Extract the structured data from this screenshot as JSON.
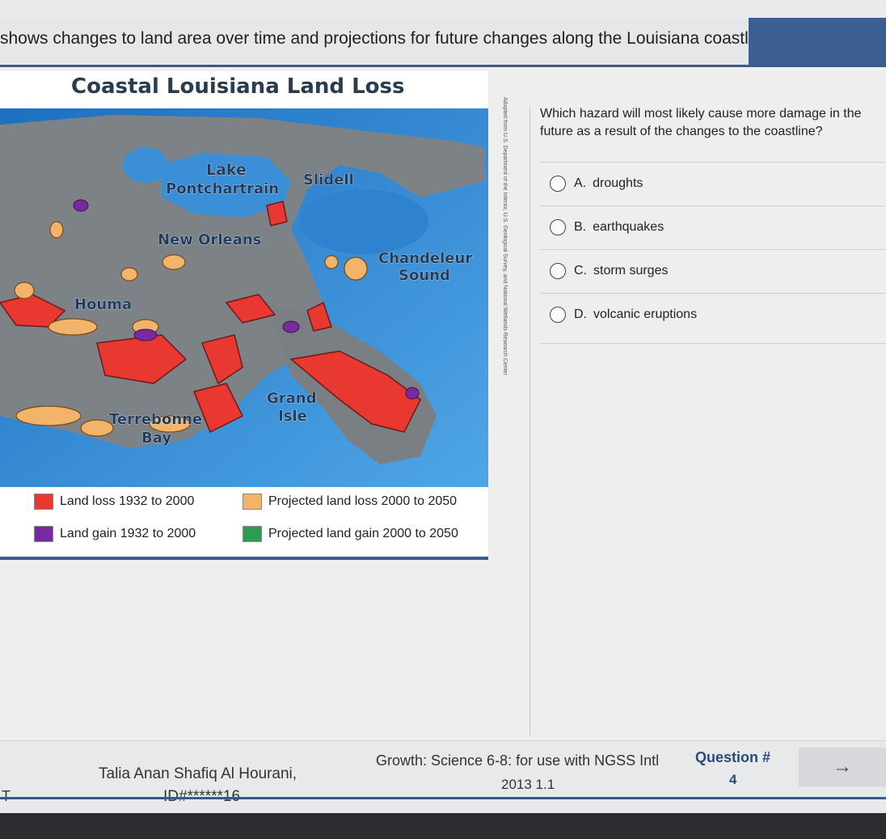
{
  "header": {
    "text": "shows changes to land area over time and projections for future changes along the Louisiana coastline."
  },
  "map": {
    "title": "Coastal Louisiana Land Loss",
    "labels": {
      "lake": "Lake",
      "pontchartrain": "Pontchartrain",
      "slidell": "Slidell",
      "new_orleans": "New Orleans",
      "chandeleur": "Chandeleur",
      "sound": "Sound",
      "houma": "Houma",
      "grand": "Grand",
      "isle": "Isle",
      "terrebonne": "Terrebonne",
      "bay": "Bay"
    },
    "credit": "Adapted from U.S. Department of the Interior, U.S. Geological Survey, and National Wetlands Research Center",
    "legend": [
      {
        "label": "Land loss 1932 to 2000",
        "color": "#e8382f"
      },
      {
        "label": "Projected land loss 2000 to 2050",
        "color": "#f2b36a"
      },
      {
        "label": "Land gain 1932 to 2000",
        "color": "#7a2aa0"
      },
      {
        "label": "Projected land gain 2000 to 2050",
        "color": "#2e9a52"
      }
    ]
  },
  "question": {
    "prompt_line1": "Which hazard will most likely cause more damage in the",
    "prompt_line2": "future as a result of the changes to the coastline?",
    "choices": [
      {
        "letter": "A.",
        "text": "droughts"
      },
      {
        "letter": "B.",
        "text": "earthquakes"
      },
      {
        "letter": "C.",
        "text": "storm surges"
      },
      {
        "letter": "D.",
        "text": "volcanic eruptions"
      }
    ]
  },
  "footer": {
    "left_mark": "T",
    "student_name": "Talia Anan Shafiq Al Hourani,",
    "student_id": "ID#******16",
    "course_line1": "Growth: Science 6-8: for use with NGSS Intl",
    "course_line2": "2013 1.1",
    "question_label": "Question #",
    "question_number": "4",
    "next_arrow": "→"
  },
  "colors": {
    "accent": "#3a5a8c",
    "water": "#3b8fd6",
    "land": "#7d8286"
  }
}
